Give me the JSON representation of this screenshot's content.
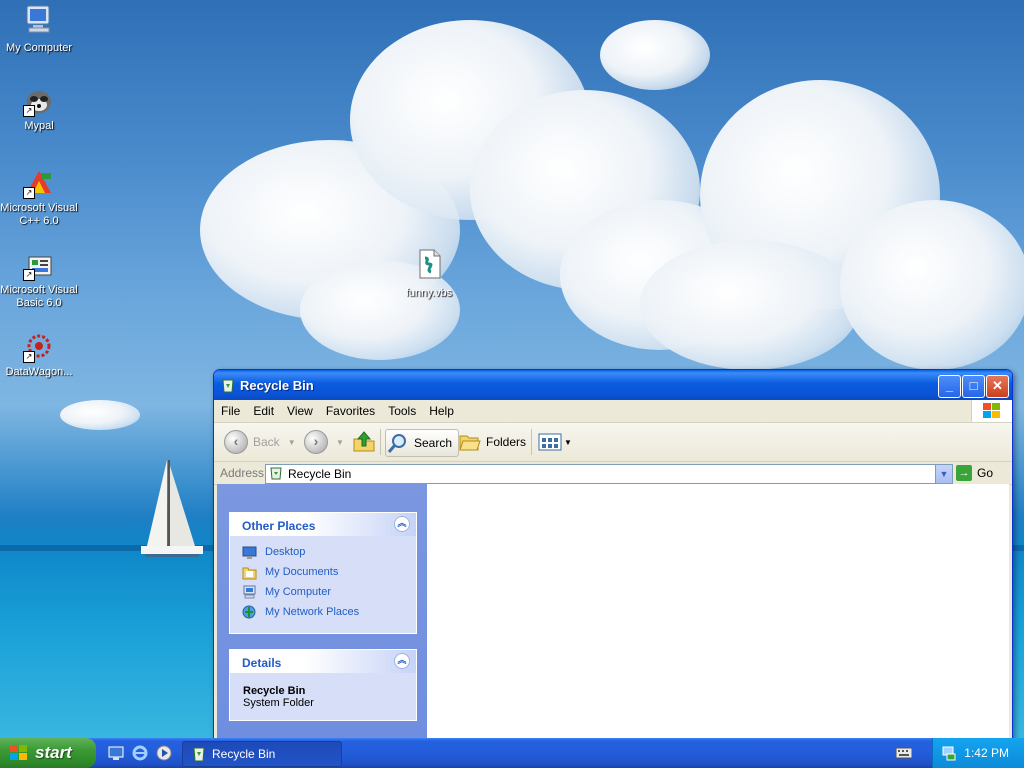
{
  "desktop": {
    "icons": [
      {
        "label": "My Computer"
      },
      {
        "label": "Mypal"
      },
      {
        "label": "Microsoft Visual C++ 6.0"
      },
      {
        "label": "Microsoft Visual Basic 6.0"
      },
      {
        "label": "DataWagon..."
      },
      {
        "label": "funny.vbs"
      }
    ]
  },
  "window": {
    "title": "Recycle Bin",
    "menu": [
      "File",
      "Edit",
      "View",
      "Favorites",
      "Tools",
      "Help"
    ],
    "toolbar": {
      "back_label": "Back",
      "search_label": "Search",
      "folders_label": "Folders"
    },
    "address": {
      "label": "Address",
      "value": "Recycle Bin",
      "go_label": "Go"
    },
    "taskpane": {
      "other_places": {
        "title": "Other Places",
        "links": [
          "Desktop",
          "My Documents",
          "My Computer",
          "My Network Places"
        ]
      },
      "details": {
        "title": "Details",
        "name": "Recycle Bin",
        "type": "System Folder"
      }
    }
  },
  "taskbar": {
    "start_label": "start",
    "task_item": "Recycle Bin",
    "clock": "1:42 PM"
  }
}
